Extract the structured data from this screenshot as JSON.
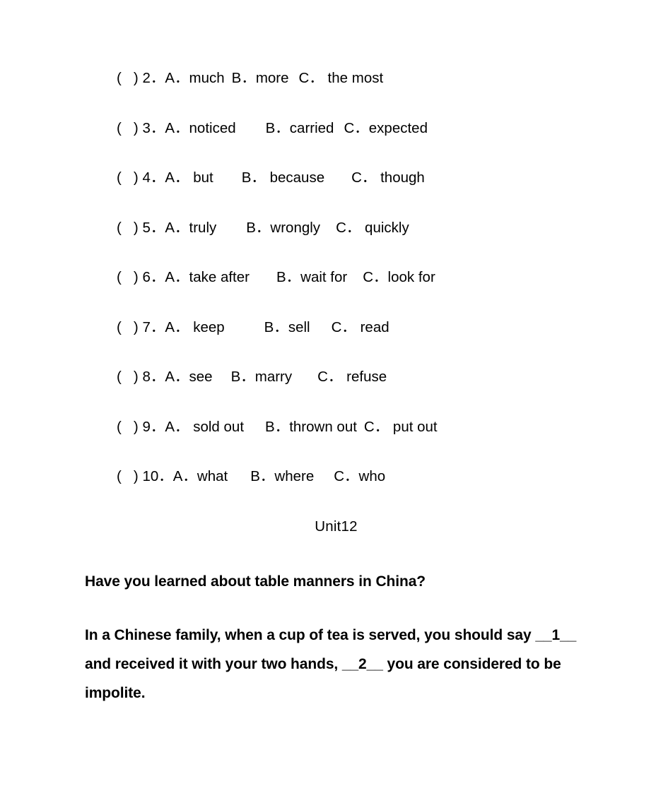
{
  "document": {
    "page_background": "#ffffff",
    "text_color": "#000000"
  },
  "multiple_choice": {
    "bracket": "(   ) ",
    "rows": [
      {
        "number": "2．",
        "options": [
          {
            "label": "A．",
            "text": "much",
            "gap": 0
          },
          {
            "label": "B．",
            "text": "more",
            "gap": 10
          },
          {
            "label": "C．",
            "text": " the most",
            "gap": 14
          }
        ]
      },
      {
        "number": "3．",
        "options": [
          {
            "label": "A．",
            "text": "noticed",
            "gap": 0
          },
          {
            "label": "B．",
            "text": "carried",
            "gap": 42
          },
          {
            "label": "C．",
            "text": "expected",
            "gap": 14
          }
        ]
      },
      {
        "number": "4．",
        "options": [
          {
            "label": "A．",
            "text": " but",
            "gap": 0
          },
          {
            "label": "B．",
            "text": " because",
            "gap": 40
          },
          {
            "label": "C．",
            "text": " though",
            "gap": 38
          }
        ]
      },
      {
        "number": "5．",
        "options": [
          {
            "label": "A．",
            "text": "truly",
            "gap": 0
          },
          {
            "label": "B．",
            "text": "wrongly",
            "gap": 42
          },
          {
            "label": "C．",
            "text": " quickly",
            "gap": 22
          }
        ]
      },
      {
        "number": "6．",
        "options": [
          {
            "label": "A．",
            "text": "take after",
            "gap": 0
          },
          {
            "label": "B．",
            "text": "wait for",
            "gap": 38
          },
          {
            "label": "C．",
            "text": "look for",
            "gap": 22
          }
        ]
      },
      {
        "number": "7．",
        "options": [
          {
            "label": "A．",
            "text": " keep",
            "gap": 0
          },
          {
            "label": "B．",
            "text": "sell",
            "gap": 56
          },
          {
            "label": "C．",
            "text": " read",
            "gap": 30
          }
        ]
      },
      {
        "number": "8．",
        "options": [
          {
            "label": "A．",
            "text": "see",
            "gap": 0
          },
          {
            "label": "B．",
            "text": "marry",
            "gap": 26
          },
          {
            "label": "C．",
            "text": " refuse",
            "gap": 36
          }
        ]
      },
      {
        "number": "9．",
        "options": [
          {
            "label": "A．",
            "text": " sold out",
            "gap": 0
          },
          {
            "label": "B．",
            "text": "thrown out",
            "gap": 30
          },
          {
            "label": "C．",
            "text": " put out",
            "gap": 10
          }
        ]
      },
      {
        "number": "10．",
        "options": [
          {
            "label": "A．",
            "text": "what",
            "gap": 0
          },
          {
            "label": "B．",
            "text": "where",
            "gap": 32
          },
          {
            "label": "C．",
            "text": "who",
            "gap": 28
          }
        ]
      }
    ]
  },
  "unit_heading": {
    "text": "Unit12"
  },
  "passage": {
    "title": "Have you learned about table manners in China?",
    "body_part_1": "In a Chinese family, when a cup of tea is served, you should say ",
    "blank_1": "__1__",
    "body_part_2": " and received it with your two hands, ",
    "blank_2": "__2__",
    "body_part_3": " you are considered to be impolite."
  }
}
